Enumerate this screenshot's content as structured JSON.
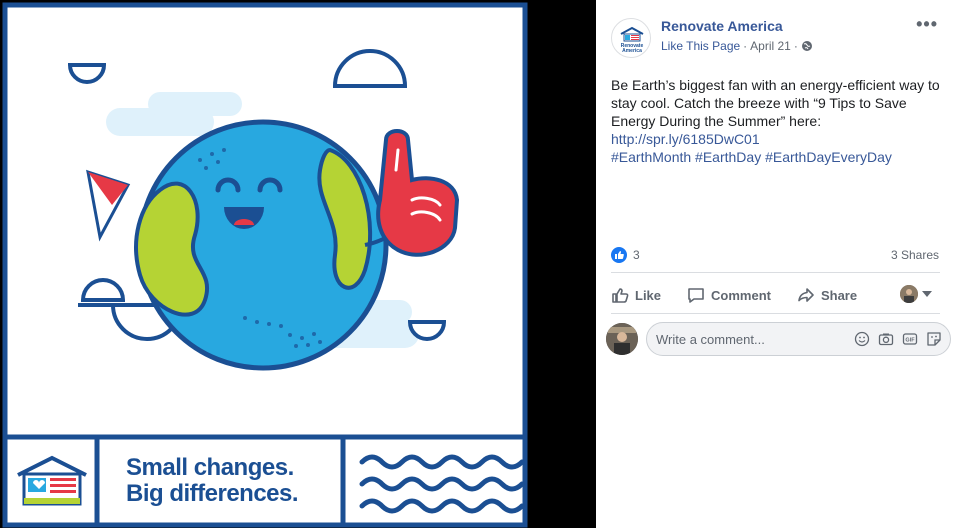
{
  "photo": {
    "tagline_line1": "Small changes.",
    "tagline_line2": "Big differences.",
    "colors": {
      "navy": "#1b4f93",
      "earth_blue": "#28a8e0",
      "land_green": "#b5d334",
      "foam_red": "#e63946",
      "cloud": "#dff1fb"
    }
  },
  "post": {
    "page_name": "Renovate America",
    "avatar_text": "Renovate America",
    "like_page": "Like This Page",
    "separator": " · ",
    "date": "April 21",
    "separator2": " · ",
    "audience_icon": "globe-icon",
    "more_label": "•••",
    "text_line": "Be Earth’s biggest fan with an energy-efficient way to stay cool. Catch the breeze with “9 Tips to Save Energy During the Summer” here:",
    "link": "http://spr.ly/6185DwC01",
    "hashtags": "#EarthMonth #EarthDay #EarthDayEveryDay"
  },
  "stats": {
    "reaction_count": "3",
    "shares": "3 Shares"
  },
  "actions": {
    "like": "Like",
    "comment": "Comment",
    "share": "Share"
  },
  "composer": {
    "placeholder": "Write a comment...",
    "icons": [
      "emoji-icon",
      "camera-icon",
      "gif-icon",
      "sticker-icon"
    ]
  }
}
